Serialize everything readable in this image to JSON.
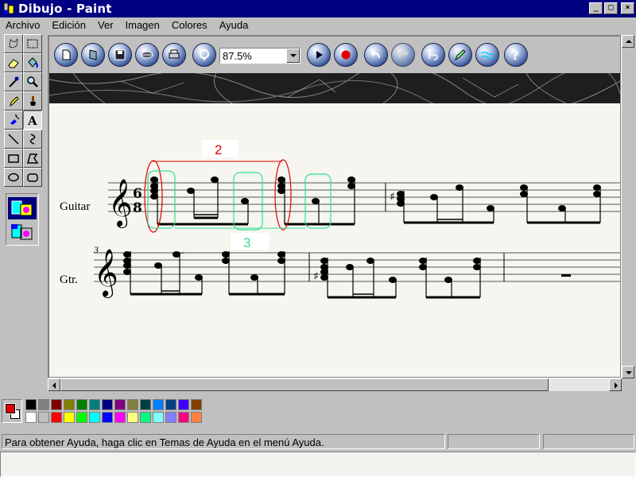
{
  "window": {
    "title": "Dibujo - Paint",
    "buttons": {
      "minimize": "_",
      "maximize": "□",
      "close": "×"
    }
  },
  "menu": [
    {
      "label": "Archivo"
    },
    {
      "label": "Edición"
    },
    {
      "label": "Ver"
    },
    {
      "label": "Imagen"
    },
    {
      "label": "Colores"
    },
    {
      "label": "Ayuda"
    }
  ],
  "tools": [
    "free-select-icon",
    "rect-select-icon",
    "eraser-icon",
    "fill-bucket-icon",
    "color-picker-icon",
    "magnifier-icon",
    "pencil-icon",
    "brush-icon",
    "airbrush-icon",
    "text-icon",
    "line-icon",
    "curve-icon",
    "rectangle-icon",
    "polygon-icon",
    "ellipse-icon",
    "rounded-rect-icon"
  ],
  "toolbar": {
    "icons": [
      "new-document-icon",
      "open-icon",
      "save-icon",
      "print-icon",
      "print-preview-icon",
      "tuner-icon",
      "play-icon",
      "record-icon",
      "undo-icon",
      "redo-icon",
      "notation-icon",
      "pencil-edit-icon",
      "waves-icon",
      "help-icon"
    ],
    "zoom": "87.5%"
  },
  "score": {
    "system1": {
      "instrument": "Guitar",
      "time_top": "6",
      "time_bottom": "8"
    },
    "system2": {
      "instrument": "Gtr.",
      "measure_number": "3"
    },
    "annotations": {
      "red_label": "2",
      "green_label": "3"
    }
  },
  "palette": {
    "foreground": "#e00000",
    "background": "#ffffff",
    "row1": [
      "#000000",
      "#808080",
      "#800000",
      "#808000",
      "#008000",
      "#008080",
      "#000080",
      "#800080",
      "#808040",
      "#004040",
      "#0080ff",
      "#004080",
      "#4000ff",
      "#804000"
    ],
    "row2": [
      "#ffffff",
      "#c0c0c0",
      "#ff0000",
      "#ffff00",
      "#00ff00",
      "#00ffff",
      "#0000ff",
      "#ff00ff",
      "#ffff80",
      "#00ff80",
      "#80ffff",
      "#8080ff",
      "#ff0080",
      "#ff8040"
    ]
  },
  "status": {
    "text": "Para obtener Ayuda, haga clic en Temas de Ayuda en el menú Ayuda."
  }
}
